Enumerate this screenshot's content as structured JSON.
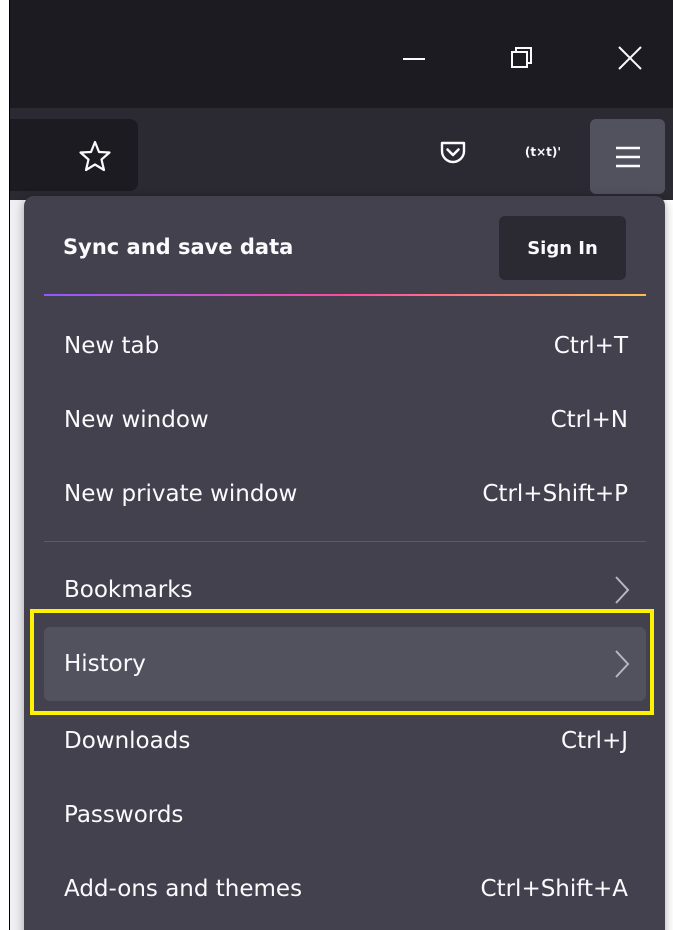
{
  "window": {
    "controls": [
      {
        "name": "minimize-icon"
      },
      {
        "name": "restore-icon"
      },
      {
        "name": "close-icon"
      }
    ]
  },
  "toolbar": {
    "icons": [
      "star-icon",
      "pocket-icon",
      "text-extension-icon",
      "hamburger-menu-icon"
    ],
    "extension_text": "(t×t)'"
  },
  "menu": {
    "sync": {
      "title": "Sync and save data",
      "sign_in_label": "Sign In"
    },
    "items": [
      {
        "label": "New tab",
        "shortcut": "Ctrl+T"
      },
      {
        "label": "New window",
        "shortcut": "Ctrl+N"
      },
      {
        "label": "New private window",
        "shortcut": "Ctrl+Shift+P"
      },
      {
        "label": "Bookmarks",
        "shortcut": ""
      },
      {
        "label": "History",
        "shortcut": ""
      },
      {
        "label": "Downloads",
        "shortcut": "Ctrl+J"
      },
      {
        "label": "Passwords",
        "shortcut": ""
      },
      {
        "label": "Add-ons and themes",
        "shortcut": "Ctrl+Shift+A"
      }
    ]
  },
  "colors": {
    "menu_bg": "#42414d",
    "highlight_border": "#fff200",
    "hover_bg": "#52525e"
  }
}
